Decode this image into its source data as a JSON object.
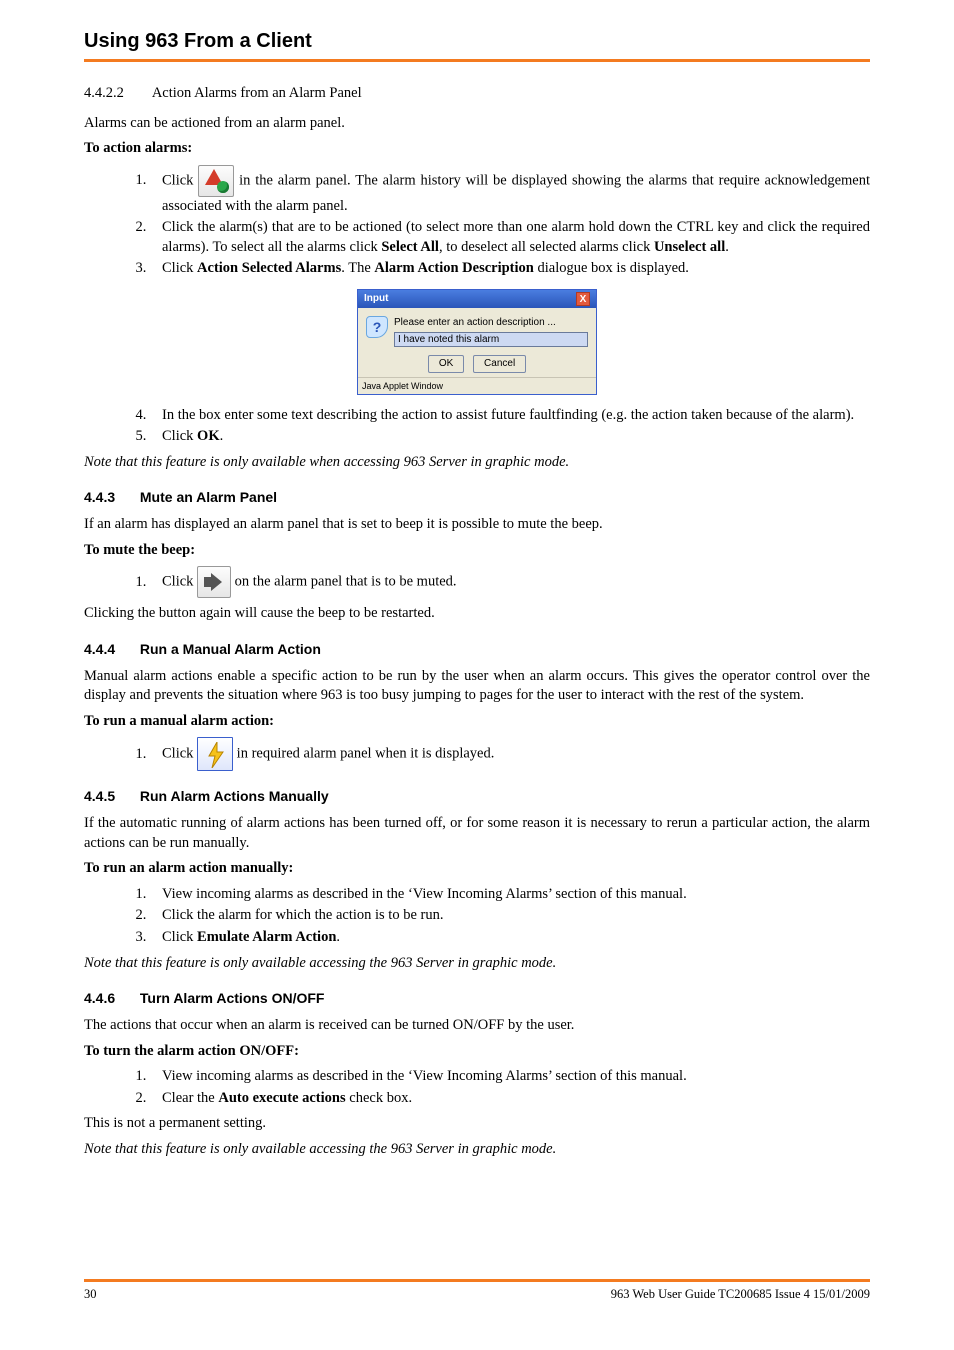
{
  "header": {
    "title": "Using 963 From a Client"
  },
  "s44222": {
    "num": "4.4.2.2",
    "title": "Action Alarms from an Alarm Panel",
    "intro": "Alarms can be actioned from an alarm panel.",
    "proc_label": "To action alarms:",
    "step1a": "Click ",
    "step1b": " in the alarm panel. The alarm history will be displayed showing the alarms that require acknowledgement associated with the alarm panel.",
    "step2a": "Click the alarm(s) that are to be actioned (to select more than one alarm hold down the CTRL key and click the required alarms). To select all the alarms click ",
    "step2_sel": "Select All",
    "step2b": ", to deselect all selected alarms click ",
    "step2_uns": "Unselect all",
    "step2c": ".",
    "step3a": "Click ",
    "step3_asa": "Action Selected Alarms",
    "step3b": ". The ",
    "step3_aad": "Alarm Action Description",
    "step3c": " dialogue box is displayed.",
    "step4": "In the box enter some text describing the action to assist future faultfinding (e.g. the action taken because of the alarm).",
    "step5a": "Click ",
    "step5_ok": "OK",
    "step5b": ".",
    "note": "Note that this feature is only available when accessing 963 Server in graphic mode."
  },
  "dialog": {
    "title": "Input",
    "message": "Please enter an action description ...",
    "input_value": "I have noted this alarm",
    "ok": "OK",
    "cancel": "Cancel",
    "status": "Java Applet Window"
  },
  "s443": {
    "num": "4.4.3",
    "title": "Mute an Alarm Panel",
    "intro": "If an alarm has displayed an alarm panel that is set to beep it is possible to mute the beep.",
    "proc_label": "To mute the beep:",
    "step1a": "Click ",
    "step1b": " on the alarm panel that is to be muted.",
    "outro": "Clicking the button again will cause the beep to be restarted."
  },
  "s444": {
    "num": "4.4.4",
    "title": "Run a Manual Alarm Action",
    "intro": "Manual alarm actions enable a specific action to be run by the user when an alarm occurs. This gives the operator control over the display and prevents the situation where 963 is too busy jumping to pages for the user to interact with the rest of the system.",
    "proc_label": "To run a manual alarm action:",
    "step1a": "Click ",
    "step1b": " in required alarm panel when it is displayed."
  },
  "s445": {
    "num": "4.4.5",
    "title": "Run Alarm Actions Manually",
    "intro": "If the automatic running of alarm actions has been turned off, or for some reason it is necessary to rerun a particular action, the alarm actions can be run manually.",
    "proc_label": "To run an alarm action manually:",
    "step1": "View incoming alarms as described in the ‘View Incoming Alarms’ section of this manual.",
    "step2": "Click the alarm for which the action is to be run.",
    "step3a": "Click ",
    "step3_eaa": "Emulate Alarm Action",
    "step3b": ".",
    "note": "Note that this feature is only available accessing the 963 Server in graphic mode."
  },
  "s446": {
    "num": "4.4.6",
    "title": "Turn Alarm Actions ON/OFF",
    "intro": "The actions that occur when an alarm is received can be turned ON/OFF by the user.",
    "proc_label": "To turn the alarm action ON/OFF:",
    "step1": "View incoming alarms as described in the ‘View Incoming Alarms’ section of this manual.",
    "step2a": "Clear the ",
    "step2_aea": "Auto execute actions",
    "step2b": " check box.",
    "outro": "This is not a permanent setting.",
    "note": "Note that this feature is only available accessing the 963 Server in graphic mode."
  },
  "footer": {
    "page": "30",
    "doc": "963 Web User Guide TC200685 Issue 4 15/01/2009"
  }
}
